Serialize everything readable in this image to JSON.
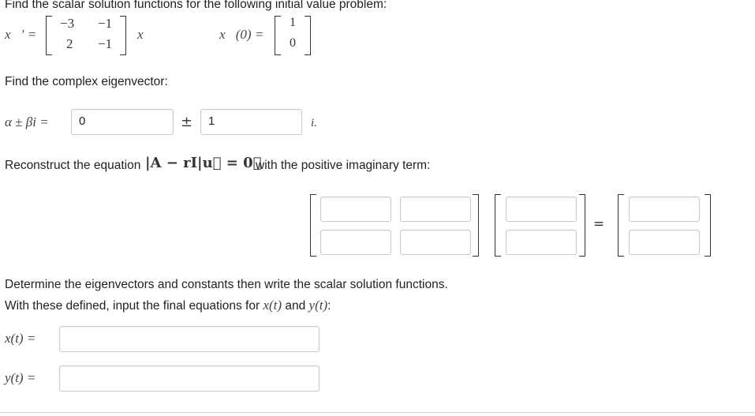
{
  "problem": {
    "prompt": "Find the scalar solution functions for the following initial value problem:",
    "lhs": "x⃗′ =",
    "matrix": [
      [
        "−3",
        "−1"
      ],
      [
        "2",
        "−1"
      ]
    ],
    "vec_symbol": "x⃗",
    "ic_lhs": "x⃗(0) =",
    "ic_vector": [
      "1",
      "0"
    ]
  },
  "eigen": {
    "prompt": "Find the complex eigenvector:",
    "lhs": "α ± βi =",
    "alpha_value": "0",
    "pm": "±",
    "beta_value": "1",
    "suffix": "i."
  },
  "reconstruct": {
    "prompt_before": "Reconstruct the equation",
    "equation": "|A − rI|u⃗ = 0⃗",
    "prompt_after": "with the positive imaginary term:",
    "equals": "="
  },
  "final": {
    "line1": "Determine the eigenvectors and constants then write the scalar solution functions.",
    "line2_before": "With these defined, input the final equations for",
    "x_of_t": "x(t)",
    "and": "and",
    "y_of_t": "y(t)",
    "colon": ":",
    "x_label": "x(t) =",
    "y_label": "y(t) ="
  }
}
